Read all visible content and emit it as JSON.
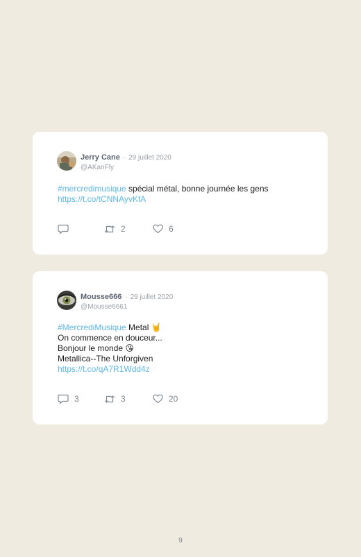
{
  "tweets": [
    {
      "author": "Jerry Cane",
      "separator": "·",
      "date": "29 juillet 2020",
      "handle": "@AKanFly",
      "avatar_icon": "avatar-photo-icon",
      "hashtag": "#mercredimusique",
      "text_after_hashtag": " spécial métal, bonne journée les gens",
      "link": "https://t.co/tCNNAyvKfA",
      "replies": "",
      "retweets": "2",
      "likes": "6"
    },
    {
      "author": "Mousse666",
      "separator": "·",
      "date": "29 juillet 2020",
      "handle": "@Mousse6661",
      "avatar_icon": "eye-avatar-icon",
      "hashtag": "#MercrediMusique",
      "text_after_hashtag": " Metal 🤘",
      "lines": [
        "On commence en douceur...",
        "Bonjour le monde 😘",
        "Metallica--The Unforgiven"
      ],
      "link": "https://t.co/qA7R1Wdd4z",
      "replies": "3",
      "retweets": "3",
      "likes": "20"
    }
  ],
  "icons": {
    "reply": "reply-icon",
    "retweet": "retweet-icon",
    "like": "heart-icon"
  },
  "colors": {
    "background": "#efebe0",
    "card": "#ffffff",
    "link": "#5cb8e6",
    "meta": "#9aa2ab"
  },
  "page_number": "9"
}
